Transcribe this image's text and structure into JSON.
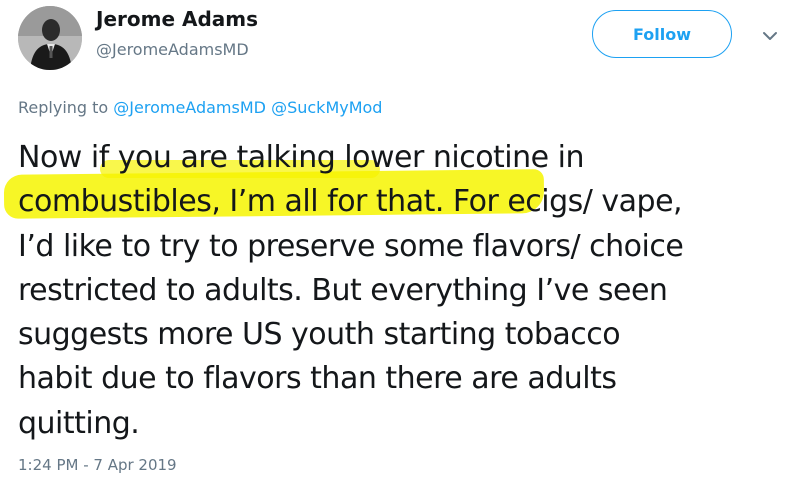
{
  "author": {
    "display_name": "Jerome Adams",
    "handle": "@JeromeAdamsMD",
    "avatar_icon": "profile-photo"
  },
  "actions": {
    "follow_label": "Follow",
    "more_icon": "chevron-down-icon"
  },
  "reply": {
    "prefix": "Replying to",
    "mentions": [
      "@JeromeAdamsMD",
      "@SuckMyMod"
    ]
  },
  "tweet": {
    "lines": [
      "Now if you are talking lower nicotine in",
      "combustibles, I’m all for that.  For ecigs/ vape,",
      "I’d like to try to preserve some flavors/ choice",
      "restricted to adults.  But everything I’ve seen",
      "suggests more US youth starting tobacco",
      "habit due to flavors than there are adults",
      "quitting."
    ],
    "highlighted_text": "combustibles, I’m all for that."
  },
  "timestamp": "1:24 PM - 7 Apr 2019",
  "colors": {
    "accent": "#1da1f2",
    "secondary_text": "#657786",
    "highlight": "#f6f400"
  }
}
